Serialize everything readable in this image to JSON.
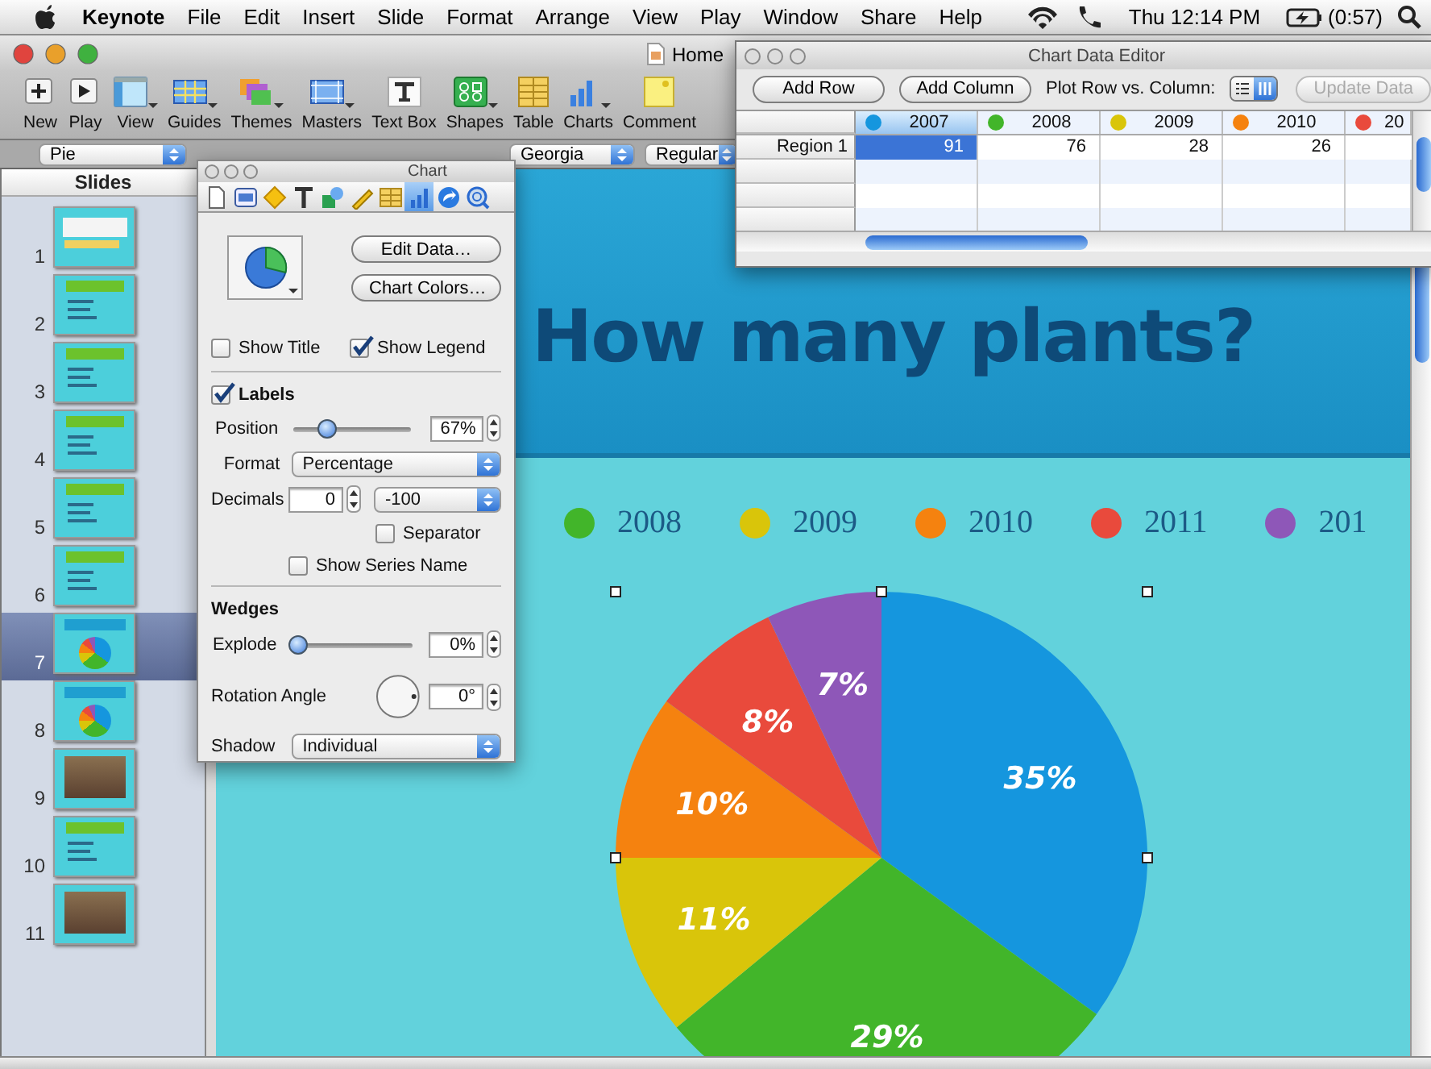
{
  "menubar": {
    "app": "Keynote",
    "menus": [
      "File",
      "Edit",
      "Insert",
      "Slide",
      "Format",
      "Arrange",
      "View",
      "Play",
      "Window",
      "Share",
      "Help"
    ],
    "clock": "Thu 12:14 PM",
    "battery": "(0:57)"
  },
  "window": {
    "title": "Home"
  },
  "toolbar": [
    {
      "label": "New",
      "menu": false
    },
    {
      "label": "Play",
      "menu": false
    },
    {
      "label": "View",
      "menu": true
    },
    {
      "label": "Guides",
      "menu": true
    },
    {
      "label": "Themes",
      "menu": true
    },
    {
      "label": "Masters",
      "menu": true
    },
    {
      "label": "Text Box",
      "menu": false
    },
    {
      "label": "Shapes",
      "menu": true
    },
    {
      "label": "Table",
      "menu": false
    },
    {
      "label": "Charts",
      "menu": true
    },
    {
      "label": "Comment",
      "menu": false
    }
  ],
  "format_bar": [
    {
      "value": "Pie"
    },
    {
      "value": "Georgia"
    },
    {
      "value": "Regular"
    }
  ],
  "sidebar": {
    "title": "Slides",
    "slides": [
      {
        "number": "1",
        "kind": "title",
        "selected": false
      },
      {
        "number": "2",
        "kind": "bullets",
        "selected": false
      },
      {
        "number": "3",
        "kind": "bullets",
        "selected": false
      },
      {
        "number": "4",
        "kind": "bullets",
        "selected": false
      },
      {
        "number": "5",
        "kind": "bullets",
        "selected": false
      },
      {
        "number": "6",
        "kind": "bullets",
        "selected": false
      },
      {
        "number": "7",
        "kind": "chart",
        "selected": true
      },
      {
        "number": "8",
        "kind": "chart",
        "selected": false
      },
      {
        "number": "9",
        "kind": "photo",
        "selected": false
      },
      {
        "number": "10",
        "kind": "bullets",
        "selected": false
      },
      {
        "number": "11",
        "kind": "photo",
        "selected": false
      }
    ]
  },
  "slide": {
    "title": "How many plants?",
    "legend": [
      {
        "label": "2008",
        "color": "#42b52a"
      },
      {
        "label": "2009",
        "color": "#d9c50a"
      },
      {
        "label": "2010",
        "color": "#f5820f"
      },
      {
        "label": "2011",
        "color": "#e94a3c"
      },
      {
        "label": "201",
        "color": "#8e57b8"
      }
    ],
    "chart_data": {
      "type": "pie",
      "values": [
        35,
        29,
        11,
        10,
        8,
        7
      ],
      "colors": [
        "#1596de",
        "#42b52a",
        "#d9c50a",
        "#f5820f",
        "#e94a3c",
        "#8e57b8"
      ],
      "value_labels": [
        "35%",
        "29%",
        "11%",
        "10%",
        "8%",
        "7%"
      ]
    }
  },
  "inspector": {
    "title": "Chart",
    "tabs": [
      {
        "selected": false
      },
      {
        "selected": false
      },
      {
        "selected": false
      },
      {
        "selected": false
      },
      {
        "selected": false
      },
      {
        "selected": false
      },
      {
        "selected": false
      },
      {
        "selected": true
      },
      {
        "selected": false
      },
      {
        "selected": false
      }
    ],
    "edit_button": "Edit Data…",
    "colors_button": "Chart Colors…",
    "show_title": {
      "label": "Show Title",
      "checked": false
    },
    "show_legend": {
      "label": "Show Legend",
      "checked": true
    },
    "labels": {
      "label": "Labels",
      "checked": true
    },
    "position": {
      "label": "Position",
      "level": 0.25,
      "value": "67%"
    },
    "format": {
      "label": "Format",
      "value": "Percentage"
    },
    "decimals": {
      "label": "Decimals",
      "value": "0",
      "style": "-100"
    },
    "separator": {
      "label": "Separator",
      "checked": false
    },
    "show_series_name": {
      "label": "Show Series Name",
      "checked": false
    },
    "wedges_heading": "Wedges",
    "explode": {
      "label": "Explode",
      "level": 0,
      "value": "0%"
    },
    "rotation": {
      "label": "Rotation Angle",
      "value": "0°"
    },
    "shadow": {
      "label": "Shadow",
      "value": "Individual"
    }
  },
  "data_editor": {
    "title": "Chart Data Editor",
    "add_row": "Add Row",
    "add_column": "Add Column",
    "plot_label": "Plot Row vs. Column:",
    "plot_toggle": [
      {
        "selected": false
      },
      {
        "selected": true
      }
    ],
    "update": {
      "label": "Update Data",
      "disabled": true
    },
    "columns": [
      {
        "label": "2007",
        "color": "#1596de",
        "selected": true
      },
      {
        "label": "2008",
        "color": "#42b52a",
        "selected": false
      },
      {
        "label": "2009",
        "color": "#d9c50a",
        "selected": false
      },
      {
        "label": "2010",
        "color": "#f5820f",
        "selected": false
      },
      {
        "label": "20",
        "color": "#e94a3c",
        "selected": false
      }
    ],
    "rows": [
      {
        "label": "Region 1",
        "cells": [
          {
            "value": "91",
            "selected": true
          },
          {
            "value": "76",
            "selected": false
          },
          {
            "value": "28",
            "selected": false
          },
          {
            "value": "26",
            "selected": false
          }
        ]
      }
    ]
  }
}
